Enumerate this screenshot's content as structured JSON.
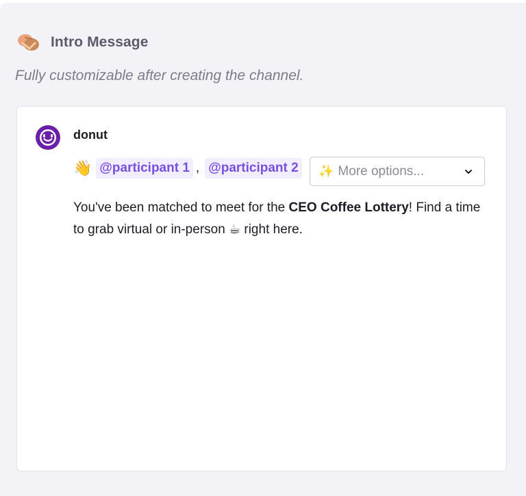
{
  "section": {
    "title": "Intro Message",
    "subtitle": "Fully customizable after creating the channel.",
    "icon": "handshake-icon"
  },
  "message": {
    "bot_name": "donut",
    "avatar_icon": "donut-bot-avatar",
    "wave_emoji": "👋",
    "mentions": [
      "@participant 1",
      "@participant 2"
    ],
    "separator": ",",
    "more_options": {
      "sparkle": "✨",
      "label": "More options...",
      "icon": "chevron-down-icon"
    },
    "body": {
      "part1": "You've been matched to meet for the ",
      "bold": "CEO Coffee Lottery",
      "part2": "! Find a time to grab virtual or in-person ",
      "coffee_emoji": "☕",
      "part3": " right here."
    }
  },
  "colors": {
    "accent": "#7a4fe0",
    "mention_bg": "#f1efff",
    "panel_bg": "#f2f2f7",
    "avatar": "#6b1fa8"
  }
}
